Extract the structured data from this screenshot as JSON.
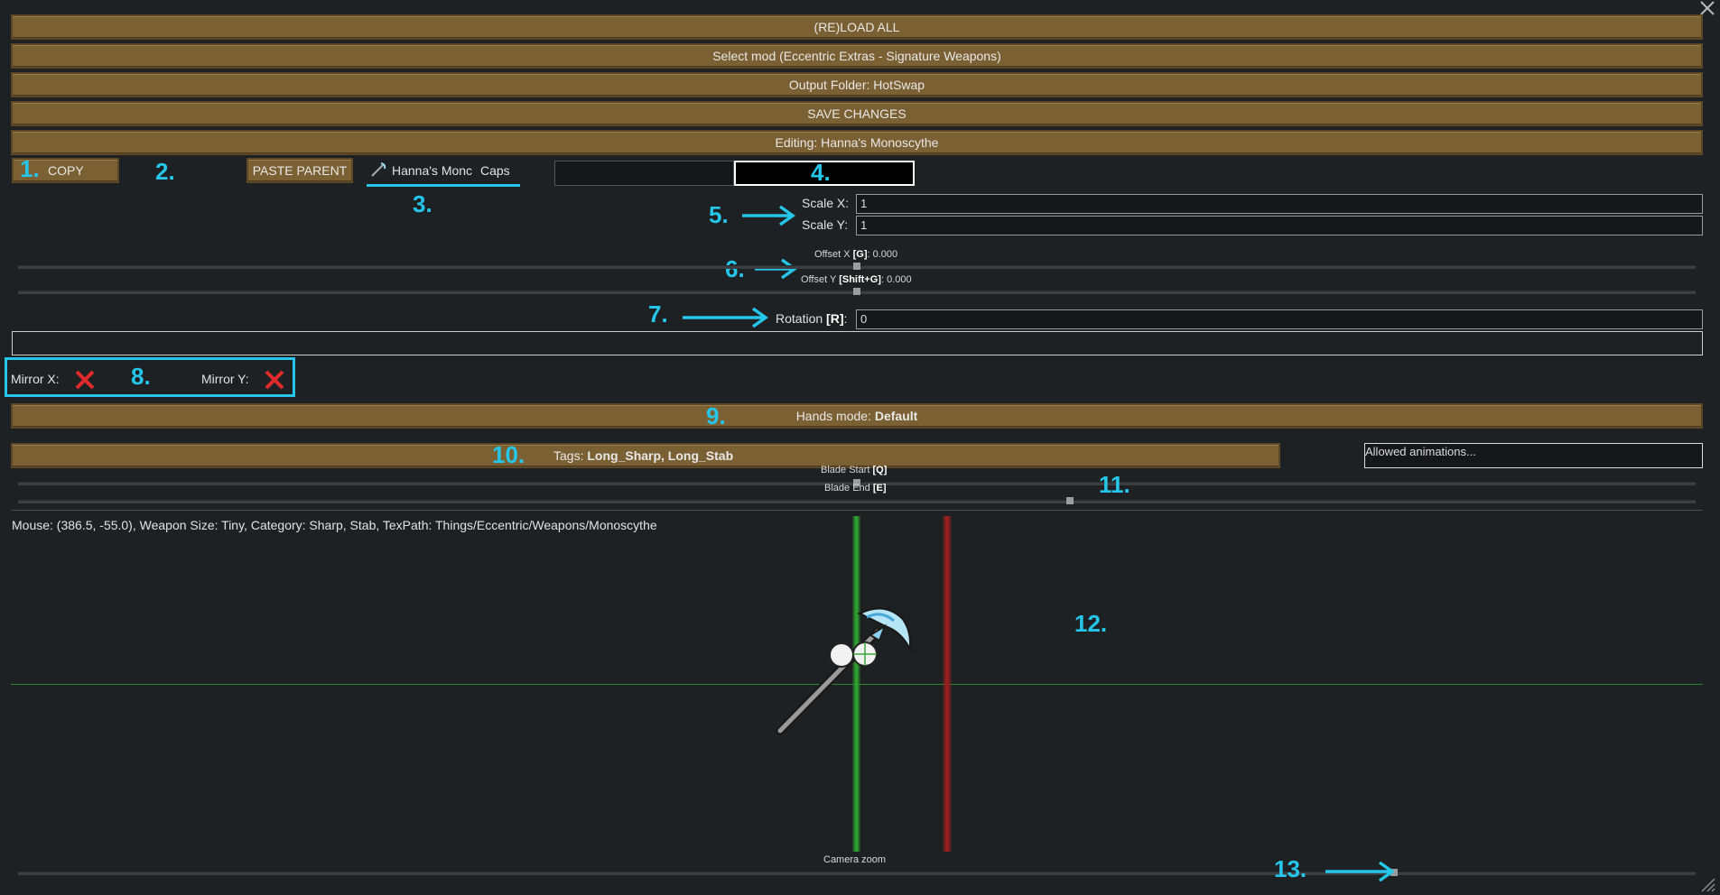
{
  "header": {
    "reload_all": "(RE)LOAD ALL",
    "select_mod": "Select mod (Eccentric Extras - Signature Weapons)",
    "output_folder": "Output Folder: HotSwap",
    "save_changes": "SAVE CHANGES",
    "editing": "Editing: Hanna's Monoscythe"
  },
  "toolbar": {
    "copy_label": "COPY",
    "paste_parent_label": "PASTE PARENT",
    "def_name": "Hanna's Monc",
    "caps_label": "Caps"
  },
  "scale": {
    "x_label": "Scale X:",
    "x_value": "1",
    "y_label": "Scale Y:",
    "y_value": "1"
  },
  "offset": {
    "x_prefix": "Offset X ",
    "x_key": "[G]",
    "x_value": ": 0.000",
    "y_prefix": "Offset Y ",
    "y_key": "[Shift+G]",
    "y_value": ": 0.000",
    "x_level": 0.5,
    "y_level": 0.5
  },
  "rotation": {
    "label_prefix": "Rotation ",
    "label_key": "[R]",
    "label_suffix": ":",
    "value": "0"
  },
  "mirror": {
    "x_label": "Mirror X:",
    "y_label": "Mirror Y:"
  },
  "hands": {
    "prefix": "Hands mode: ",
    "value": "Default"
  },
  "tags": {
    "prefix": "Tags: ",
    "value": "Long_Sharp, Long_Stab",
    "allowed_animations": "Allowed animations..."
  },
  "blade": {
    "start_label": "Blade Start ",
    "start_key": "[Q]",
    "end_label": "Blade End ",
    "end_key": "[E]",
    "start_level": 0.5,
    "end_level": 0.627
  },
  "info": {
    "status": "Mouse: (386.5, -55.0), Weapon Size: Tiny, Category: Sharp, Stab, TexPath: Things/Eccentric/Weapons/Monoscythe"
  },
  "camera": {
    "label": "Camera zoom",
    "zoom_level": 0.82
  },
  "annotations": {
    "n1": "1.",
    "n2": "2.",
    "n3": "3.",
    "n4": "4.",
    "n5": "5.",
    "n6": "6.",
    "n7": "7.",
    "n8": "8.",
    "n9": "9.",
    "n10": "10.",
    "n11": "11.",
    "n12": "12.",
    "n13": "13."
  },
  "colors": {
    "button_bg": "#7a6032",
    "annotation": "#25c6ea",
    "green_line": "#2fa12f",
    "red_line": "#9a2020"
  },
  "icons": {
    "close": "close-icon",
    "mirror_off": "red-x-icon",
    "resize": "resize-grip-icon",
    "weapon_thumb": "weapon-icon"
  }
}
